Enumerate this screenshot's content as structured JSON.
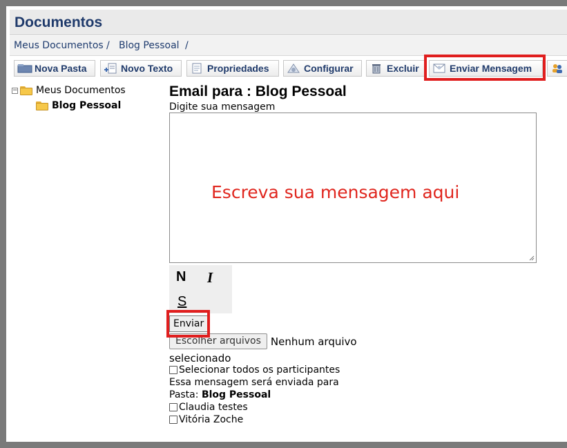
{
  "header": {
    "title": "Documentos"
  },
  "breadcrumb": {
    "items": [
      "Meus Documentos",
      "Blog Pessoal"
    ],
    "separator": "/"
  },
  "toolbar": {
    "buttons": [
      {
        "label": "Nova Pasta",
        "icon": "new-folder-icon"
      },
      {
        "label": "Novo Texto",
        "icon": "new-text-icon"
      },
      {
        "label": "Propriedades",
        "icon": "properties-icon"
      },
      {
        "label": "Configurar",
        "icon": "configure-icon"
      },
      {
        "label": "Excluir",
        "icon": "trash-icon"
      },
      {
        "label": "Enviar Mensagem",
        "icon": "send-message-icon"
      }
    ],
    "highlight_color": "#e01e1e"
  },
  "tree": {
    "expander": "−",
    "root": {
      "label": "Meus Documentos"
    },
    "child": {
      "label": "Blog Pessoal"
    }
  },
  "email": {
    "title": "Email para : Blog Pessoal",
    "prompt": "Digite sua mensagem",
    "placeholder": "Escreva sua mensagem aqui",
    "format_buttons": {
      "bold": "N",
      "italic": "I",
      "underline": "S"
    },
    "send_label": "Enviar",
    "file_button": "Escolher arquivos",
    "file_status_1": "Nenhum arquivo",
    "file_status_2": "selecionado",
    "select_all_label": "Selecionar todos os participantes",
    "info_text": "Essa mensagem será enviada para",
    "folder_label": "Pasta:",
    "folder_name": "Blog Pessoal",
    "participants": [
      "Claudia testes",
      "Vitória Zoche"
    ]
  }
}
